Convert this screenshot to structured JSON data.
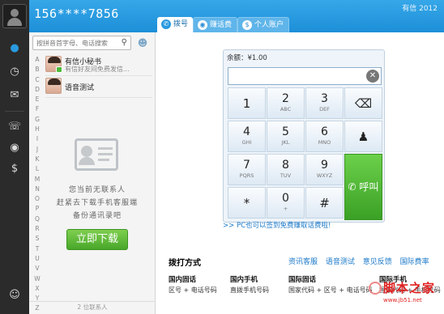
{
  "header": {
    "phone_number": "156****7856",
    "brand": "有信 2012"
  },
  "rail": {
    "icons": [
      "avatar",
      "contacts-icon",
      "history-icon",
      "message-icon",
      "call-icon",
      "money-bag-icon",
      "dollar-icon",
      "emoticon-icon"
    ]
  },
  "tabs": [
    {
      "label": "拨号",
      "icon": "phone-icon",
      "active": true
    },
    {
      "label": "赚话费",
      "icon": "money-bag-icon",
      "active": false
    },
    {
      "label": "个人账户",
      "icon": "dollar-icon",
      "active": false
    }
  ],
  "contacts": {
    "search_placeholder": "按拼音首字母、电话搜索",
    "alphabet": [
      "A",
      "B",
      "C",
      "D",
      "E",
      "F",
      "G",
      "H",
      "I",
      "J",
      "K",
      "L",
      "M",
      "N",
      "O",
      "P",
      "Q",
      "R",
      "S",
      "T",
      "U",
      "V",
      "W",
      "X",
      "Y",
      "Z",
      "#"
    ],
    "items": [
      {
        "name": "有信小秘书",
        "subtitle": "有信好友间免费发信..."
      },
      {
        "name": "语音测试",
        "subtitle": ""
      }
    ],
    "empty_text": [
      "您当前无联系人",
      "赶紧去下载手机客服端",
      "备份通讯录吧"
    ],
    "download_label": "立即下载",
    "footer": "2 位联系人"
  },
  "dialer": {
    "balance": "余额：¥1.00",
    "number_value": "",
    "keys": [
      {
        "digit": "1",
        "letters": ""
      },
      {
        "digit": "2",
        "letters": "ABC"
      },
      {
        "digit": "3",
        "letters": "DEF"
      },
      {
        "digit": "4",
        "letters": "GHI"
      },
      {
        "digit": "5",
        "letters": "JKL"
      },
      {
        "digit": "6",
        "letters": "MNO"
      },
      {
        "digit": "7",
        "letters": "PQRS"
      },
      {
        "digit": "8",
        "letters": "TUV"
      },
      {
        "digit": "9",
        "letters": "WXYZ"
      },
      {
        "digit": "*",
        "letters": ""
      },
      {
        "digit": "0",
        "letters": "+"
      },
      {
        "digit": "#",
        "letters": ""
      }
    ],
    "side_keys": [
      "backspace-icon",
      "add-contact-icon"
    ],
    "call_label": "呼叫",
    "promo": ">> PC也可以签到免费赚取话费啦!"
  },
  "methods": {
    "title": "拨打方式",
    "links": [
      "资讯客服",
      "语音测试",
      "意见反馈",
      "国际费率"
    ],
    "columns": [
      {
        "heading": "国内固话",
        "value": "区号 + 电话号码"
      },
      {
        "heading": "国内手机",
        "value": "直拨手机号码"
      },
      {
        "heading": "国际固话",
        "value": "国家代码 + 区号 + 电话号码"
      },
      {
        "heading": "国际手机",
        "value": "国家代码 + 手机号码"
      }
    ]
  },
  "watermark": {
    "title": "脚本之家",
    "url": "www.jb51.net"
  }
}
